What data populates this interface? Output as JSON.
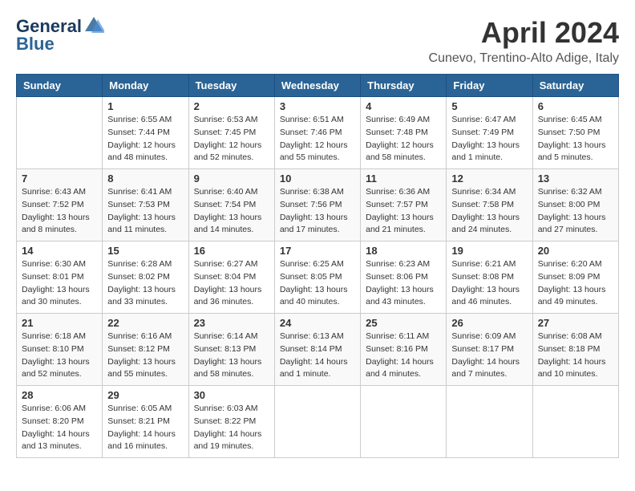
{
  "logo": {
    "line1": "General",
    "line2": "Blue"
  },
  "title": "April 2024",
  "location": "Cunevo, Trentino-Alto Adige, Italy",
  "days_of_week": [
    "Sunday",
    "Monday",
    "Tuesday",
    "Wednesday",
    "Thursday",
    "Friday",
    "Saturday"
  ],
  "weeks": [
    [
      {
        "day": "",
        "sunrise": "",
        "sunset": "",
        "daylight": ""
      },
      {
        "day": "1",
        "sunrise": "Sunrise: 6:55 AM",
        "sunset": "Sunset: 7:44 PM",
        "daylight": "Daylight: 12 hours and 48 minutes."
      },
      {
        "day": "2",
        "sunrise": "Sunrise: 6:53 AM",
        "sunset": "Sunset: 7:45 PM",
        "daylight": "Daylight: 12 hours and 52 minutes."
      },
      {
        "day": "3",
        "sunrise": "Sunrise: 6:51 AM",
        "sunset": "Sunset: 7:46 PM",
        "daylight": "Daylight: 12 hours and 55 minutes."
      },
      {
        "day": "4",
        "sunrise": "Sunrise: 6:49 AM",
        "sunset": "Sunset: 7:48 PM",
        "daylight": "Daylight: 12 hours and 58 minutes."
      },
      {
        "day": "5",
        "sunrise": "Sunrise: 6:47 AM",
        "sunset": "Sunset: 7:49 PM",
        "daylight": "Daylight: 13 hours and 1 minute."
      },
      {
        "day": "6",
        "sunrise": "Sunrise: 6:45 AM",
        "sunset": "Sunset: 7:50 PM",
        "daylight": "Daylight: 13 hours and 5 minutes."
      }
    ],
    [
      {
        "day": "7",
        "sunrise": "Sunrise: 6:43 AM",
        "sunset": "Sunset: 7:52 PM",
        "daylight": "Daylight: 13 hours and 8 minutes."
      },
      {
        "day": "8",
        "sunrise": "Sunrise: 6:41 AM",
        "sunset": "Sunset: 7:53 PM",
        "daylight": "Daylight: 13 hours and 11 minutes."
      },
      {
        "day": "9",
        "sunrise": "Sunrise: 6:40 AM",
        "sunset": "Sunset: 7:54 PM",
        "daylight": "Daylight: 13 hours and 14 minutes."
      },
      {
        "day": "10",
        "sunrise": "Sunrise: 6:38 AM",
        "sunset": "Sunset: 7:56 PM",
        "daylight": "Daylight: 13 hours and 17 minutes."
      },
      {
        "day": "11",
        "sunrise": "Sunrise: 6:36 AM",
        "sunset": "Sunset: 7:57 PM",
        "daylight": "Daylight: 13 hours and 21 minutes."
      },
      {
        "day": "12",
        "sunrise": "Sunrise: 6:34 AM",
        "sunset": "Sunset: 7:58 PM",
        "daylight": "Daylight: 13 hours and 24 minutes."
      },
      {
        "day": "13",
        "sunrise": "Sunrise: 6:32 AM",
        "sunset": "Sunset: 8:00 PM",
        "daylight": "Daylight: 13 hours and 27 minutes."
      }
    ],
    [
      {
        "day": "14",
        "sunrise": "Sunrise: 6:30 AM",
        "sunset": "Sunset: 8:01 PM",
        "daylight": "Daylight: 13 hours and 30 minutes."
      },
      {
        "day": "15",
        "sunrise": "Sunrise: 6:28 AM",
        "sunset": "Sunset: 8:02 PM",
        "daylight": "Daylight: 13 hours and 33 minutes."
      },
      {
        "day": "16",
        "sunrise": "Sunrise: 6:27 AM",
        "sunset": "Sunset: 8:04 PM",
        "daylight": "Daylight: 13 hours and 36 minutes."
      },
      {
        "day": "17",
        "sunrise": "Sunrise: 6:25 AM",
        "sunset": "Sunset: 8:05 PM",
        "daylight": "Daylight: 13 hours and 40 minutes."
      },
      {
        "day": "18",
        "sunrise": "Sunrise: 6:23 AM",
        "sunset": "Sunset: 8:06 PM",
        "daylight": "Daylight: 13 hours and 43 minutes."
      },
      {
        "day": "19",
        "sunrise": "Sunrise: 6:21 AM",
        "sunset": "Sunset: 8:08 PM",
        "daylight": "Daylight: 13 hours and 46 minutes."
      },
      {
        "day": "20",
        "sunrise": "Sunrise: 6:20 AM",
        "sunset": "Sunset: 8:09 PM",
        "daylight": "Daylight: 13 hours and 49 minutes."
      }
    ],
    [
      {
        "day": "21",
        "sunrise": "Sunrise: 6:18 AM",
        "sunset": "Sunset: 8:10 PM",
        "daylight": "Daylight: 13 hours and 52 minutes."
      },
      {
        "day": "22",
        "sunrise": "Sunrise: 6:16 AM",
        "sunset": "Sunset: 8:12 PM",
        "daylight": "Daylight: 13 hours and 55 minutes."
      },
      {
        "day": "23",
        "sunrise": "Sunrise: 6:14 AM",
        "sunset": "Sunset: 8:13 PM",
        "daylight": "Daylight: 13 hours and 58 minutes."
      },
      {
        "day": "24",
        "sunrise": "Sunrise: 6:13 AM",
        "sunset": "Sunset: 8:14 PM",
        "daylight": "Daylight: 14 hours and 1 minute."
      },
      {
        "day": "25",
        "sunrise": "Sunrise: 6:11 AM",
        "sunset": "Sunset: 8:16 PM",
        "daylight": "Daylight: 14 hours and 4 minutes."
      },
      {
        "day": "26",
        "sunrise": "Sunrise: 6:09 AM",
        "sunset": "Sunset: 8:17 PM",
        "daylight": "Daylight: 14 hours and 7 minutes."
      },
      {
        "day": "27",
        "sunrise": "Sunrise: 6:08 AM",
        "sunset": "Sunset: 8:18 PM",
        "daylight": "Daylight: 14 hours and 10 minutes."
      }
    ],
    [
      {
        "day": "28",
        "sunrise": "Sunrise: 6:06 AM",
        "sunset": "Sunset: 8:20 PM",
        "daylight": "Daylight: 14 hours and 13 minutes."
      },
      {
        "day": "29",
        "sunrise": "Sunrise: 6:05 AM",
        "sunset": "Sunset: 8:21 PM",
        "daylight": "Daylight: 14 hours and 16 minutes."
      },
      {
        "day": "30",
        "sunrise": "Sunrise: 6:03 AM",
        "sunset": "Sunset: 8:22 PM",
        "daylight": "Daylight: 14 hours and 19 minutes."
      },
      {
        "day": "",
        "sunrise": "",
        "sunset": "",
        "daylight": ""
      },
      {
        "day": "",
        "sunrise": "",
        "sunset": "",
        "daylight": ""
      },
      {
        "day": "",
        "sunrise": "",
        "sunset": "",
        "daylight": ""
      },
      {
        "day": "",
        "sunrise": "",
        "sunset": "",
        "daylight": ""
      }
    ]
  ]
}
